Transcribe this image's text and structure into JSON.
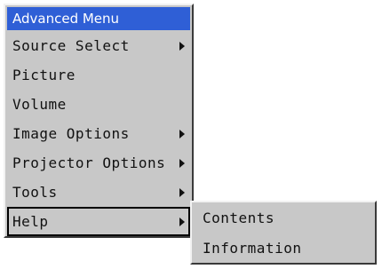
{
  "menu": {
    "title": "Advanced Menu",
    "items": [
      {
        "label": "Source Select",
        "has_submenu": true
      },
      {
        "label": "Picture",
        "has_submenu": false
      },
      {
        "label": "Volume",
        "has_submenu": false
      },
      {
        "label": "Image Options",
        "has_submenu": true
      },
      {
        "label": "Projector Options",
        "has_submenu": true
      },
      {
        "label": "Tools",
        "has_submenu": true
      },
      {
        "label": "Help",
        "has_submenu": true,
        "selected": true
      }
    ]
  },
  "submenu": {
    "items": [
      "Contents",
      "Information"
    ]
  },
  "colors": {
    "title_bar": "#2f5fd6",
    "menu_bg": "#c8c8c8"
  }
}
